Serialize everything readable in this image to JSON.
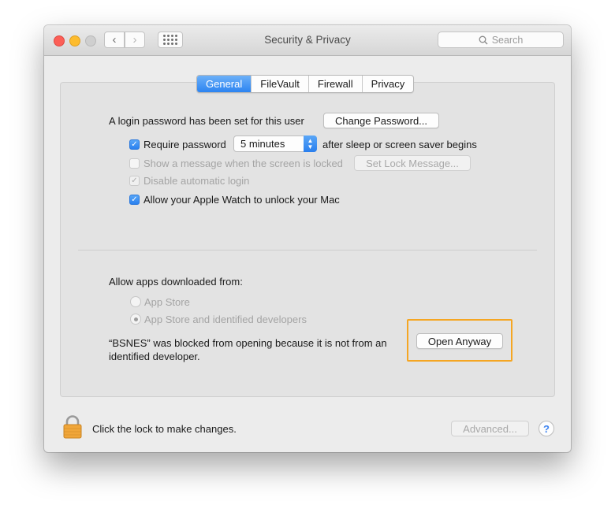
{
  "window": {
    "title": "Security & Privacy",
    "search_placeholder": "Search",
    "nav_back": "‹",
    "nav_forward": "›"
  },
  "tabs": [
    {
      "label": "General",
      "active": true
    },
    {
      "label": "FileVault",
      "active": false
    },
    {
      "label": "Firewall",
      "active": false
    },
    {
      "label": "Privacy",
      "active": false
    }
  ],
  "general": {
    "login_text": "A login password has been set for this user",
    "change_password_label": "Change Password...",
    "require_password": {
      "label": "Require password",
      "checked": true
    },
    "require_password_delay": "5 minutes",
    "require_password_suffix": "after sleep or screen saver begins",
    "show_message": {
      "label": "Show a message when the screen is locked",
      "checked": false,
      "disabled": true
    },
    "set_lock_message_label": "Set Lock Message...",
    "disable_auto_login": {
      "label": "Disable automatic login",
      "checked": true,
      "disabled": true
    },
    "apple_watch": {
      "label": "Allow your Apple Watch to unlock your Mac",
      "checked": true
    }
  },
  "allow_apps": {
    "heading": "Allow apps downloaded from:",
    "options": [
      {
        "label": "App Store",
        "selected": false
      },
      {
        "label": "App Store and identified developers",
        "selected": true
      }
    ],
    "blocked_line1": "“BSNES” was blocked from opening because it is not from an",
    "blocked_line2": "identified developer.",
    "open_anyway_label": "Open Anyway"
  },
  "footer": {
    "lock_text": "Click the lock to make changes.",
    "advanced_label": "Advanced...",
    "help_label": "?"
  },
  "colors": {
    "accent": "#2c84f1",
    "highlight": "#f5a623",
    "lock": "#f0a63a"
  }
}
